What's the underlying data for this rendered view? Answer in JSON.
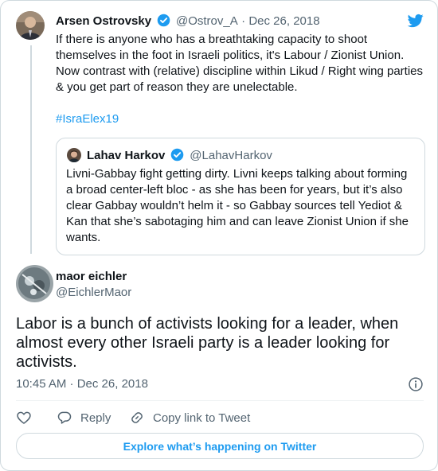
{
  "quoted_context": {
    "author": {
      "name": "Arsen Ostrovsky",
      "handle": "@Ostrov_A",
      "date": "Dec 26, 2018",
      "verified": true
    },
    "text_lines": [
      "If there is anyone who has a breathtaking capacity to shoot",
      "themselves in the foot in Israeli politics, it's Labour / Zionist Union.",
      "Now contrast with (relative) discipline within Likud / Right wing parties",
      "& you get part of reason they are unelectable."
    ],
    "hashtag": "#IsraElex19",
    "quoted_tweet": {
      "author": {
        "name": "Lahav Harkov",
        "handle": "@LahavHarkov",
        "verified": true
      },
      "text_lines": [
        "Livni-Gabbay fight getting dirty. Livni keeps talking about forming",
        "a broad center-left bloc - as she has been for years, but it’s also",
        "clear Gabbay wouldn’t helm it - so Gabbay sources tell Yediot &",
        "Kan that she’s sabotaging him and can leave Zionist Union if she",
        "wants."
      ]
    }
  },
  "tweet": {
    "author": {
      "name": "maor eichler",
      "handle": "@EichlerMaor"
    },
    "text": "Labor is a bunch of activists looking for a leader, when almost every other Israeli party is a leader looking for activists.",
    "timestamp": "10:45 AM · Dec 26, 2018"
  },
  "actions": {
    "reply_label": "Reply",
    "copy_label": "Copy link to Tweet"
  },
  "explore_label": "Explore what’s happening on Twitter",
  "colors": {
    "accent": "#1d9bf0",
    "text": "#0f1419",
    "secondary": "#536471",
    "border": "#cfd9de"
  }
}
